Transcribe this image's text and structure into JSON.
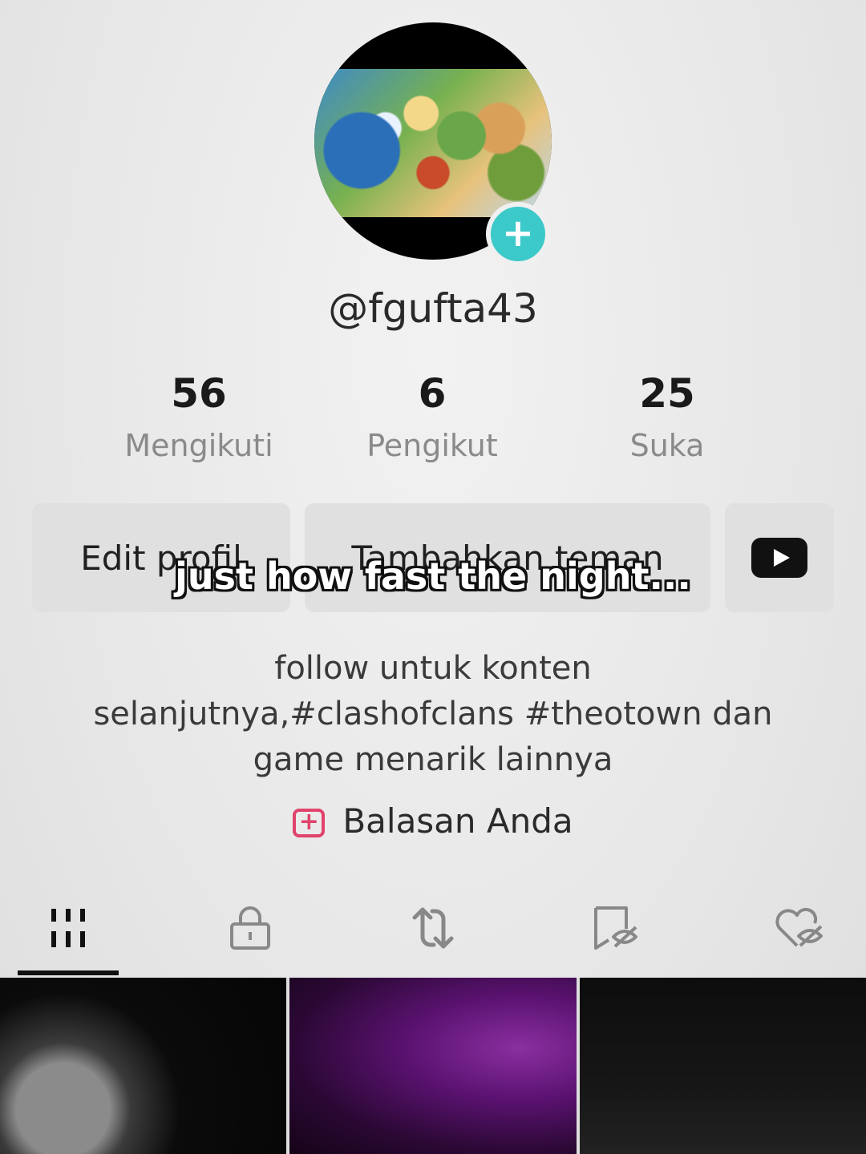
{
  "profile": {
    "username": "@fgufta43",
    "avatar_add_icon": "+",
    "stats": [
      {
        "value": "56",
        "label": "Mengikuti"
      },
      {
        "value": "6",
        "label": "Pengikut"
      },
      {
        "value": "25",
        "label": "Suka"
      }
    ],
    "buttons": {
      "edit": "Edit profil",
      "add_friends": "Tambahkan teman",
      "youtube_icon": "youtube-icon"
    },
    "bio_lines": [
      "follow untuk konten",
      "selanjutnya,#clashofclans #theotown dan",
      "game menarik lainnya"
    ],
    "replies_label": "Balasan Anda"
  },
  "overlay": {
    "caption": "just how fast the night..."
  },
  "tabs": [
    "grid-icon",
    "lock-icon",
    "repost-icon",
    "saved-hidden-icon",
    "liked-hidden-icon"
  ],
  "colors": {
    "accent_teal": "#3cc9c9",
    "reply_pink": "#e0436b"
  }
}
